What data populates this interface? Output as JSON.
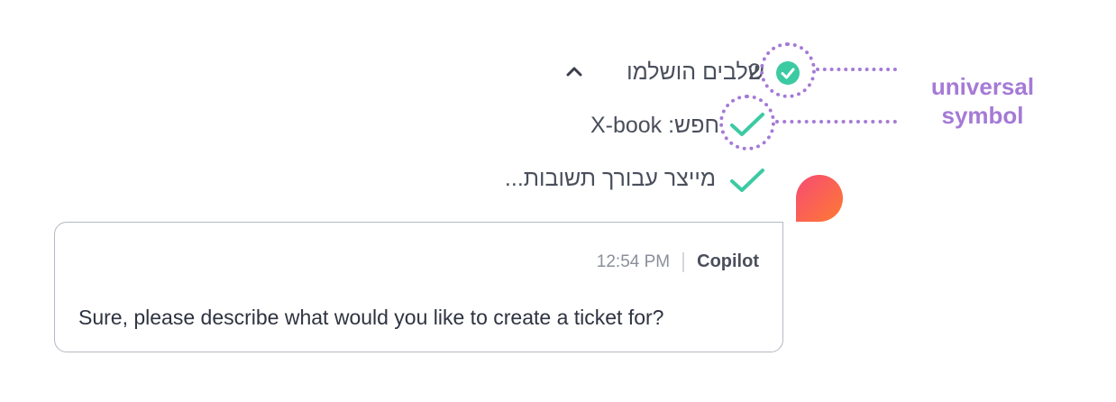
{
  "steps": {
    "count": "2",
    "completed_text": "שלבים הושלמו",
    "search_text": "חפש: X-book",
    "generating_text": "מייצר עבורך תשובות..."
  },
  "annotation": {
    "line1": "universal",
    "line2": "symbol"
  },
  "message": {
    "sender": "Copilot",
    "time": "12:54 PM",
    "text": "Sure, please describe what would you like to create a ticket for?"
  },
  "colors": {
    "check_green": "#3ccaa3",
    "annotation_purple": "#a57ad6",
    "avatar_gradient_start": "#f64b74",
    "avatar_gradient_end": "#ff7a32"
  }
}
